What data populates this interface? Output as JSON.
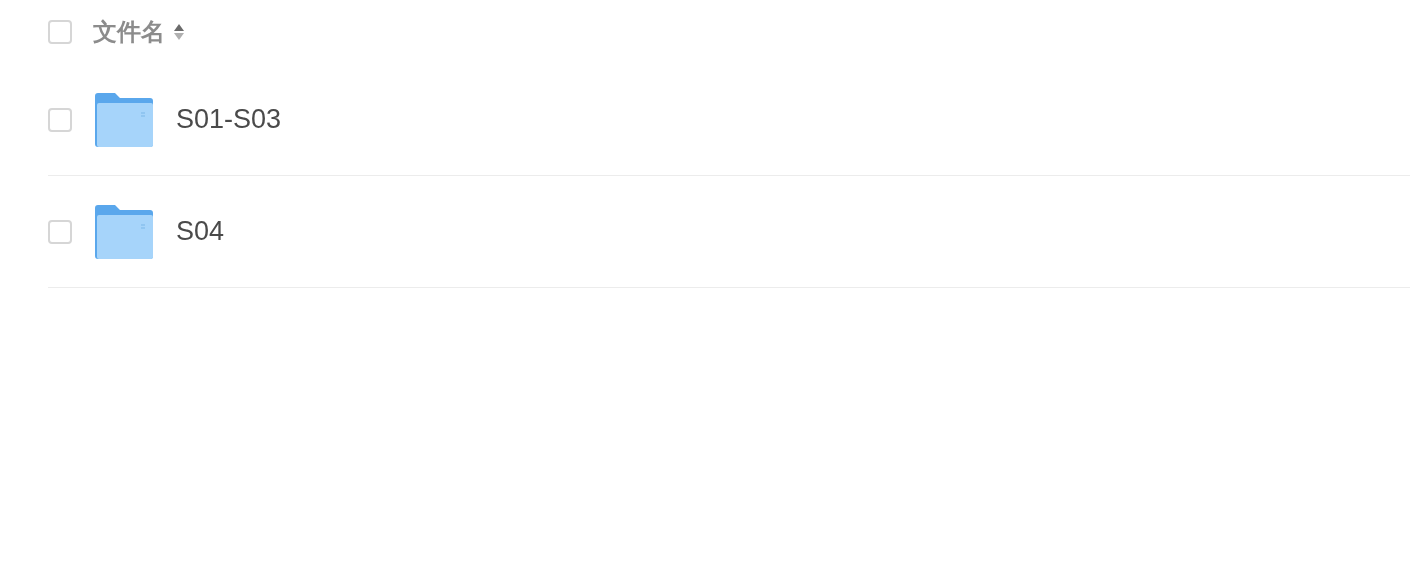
{
  "header": {
    "checked": false,
    "label": "文件名"
  },
  "rows": [
    {
      "checked": false,
      "name": "S01-S03"
    },
    {
      "checked": false,
      "name": "S04"
    }
  ]
}
